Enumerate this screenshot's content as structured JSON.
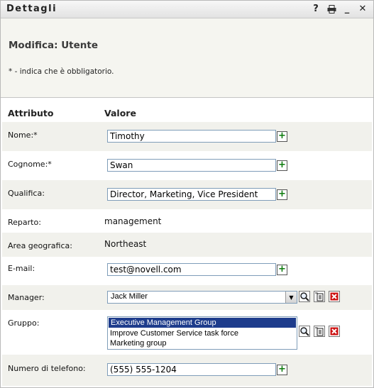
{
  "titlebar": {
    "title": "Dettagli",
    "help_glyph": "?",
    "print_glyph": "🖶",
    "minimize_glyph": "_",
    "close_glyph": "✕"
  },
  "header": {
    "heading": "Modifica: Utente",
    "required_note": "* - indica che è obbligatorio."
  },
  "columns": {
    "attribute": "Attributo",
    "value": "Valore"
  },
  "fields": {
    "nome": {
      "label": "Nome:*",
      "value": "Timothy"
    },
    "cognome": {
      "label": "Cognome:*",
      "value": "Swan"
    },
    "qualifica": {
      "label": "Qualifica:",
      "value": "Director, Marketing, Vice President"
    },
    "reparto": {
      "label": "Reparto:",
      "value": "management"
    },
    "area": {
      "label": "Area geografica:",
      "value": "Northeast"
    },
    "email": {
      "label": "E-mail:",
      "value": "test@novell.com"
    },
    "manager": {
      "label": "Manager:",
      "value": "Jack Miller"
    },
    "gruppo": {
      "label": "Gruppo:",
      "options": [
        "Executive Management Group",
        "Improve Customer Service task force",
        "Marketing group"
      ],
      "selected": "Executive Management Group"
    },
    "telefono": {
      "label": "Numero di telefono:",
      "value": "(555) 555-1204"
    }
  },
  "icons": {
    "add": "+",
    "remove": "✖"
  },
  "colors": {
    "add_green": "#0a7a0a",
    "remove_red": "#cc1111",
    "selection_blue": "#1e3c8c"
  }
}
